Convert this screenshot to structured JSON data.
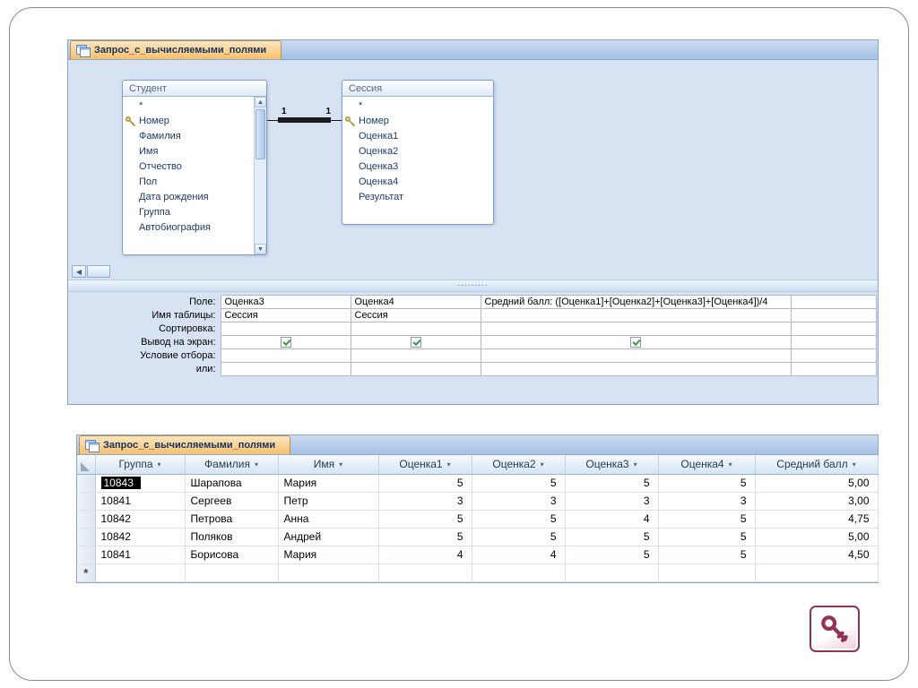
{
  "colors": {
    "design_background": "#d7e3f2",
    "active_tab": "#f7bf6b",
    "tab_strip": "#a5c1e4",
    "window_border": "#89a6c9",
    "field_text": "#1c3a6e",
    "checkbox_check": "#2f9e3f",
    "access_maroon": "#943157",
    "key_gold": "#a38f2e",
    "selected_cell_background": "#000000"
  },
  "design_window": {
    "tab_title": "Запрос_с_вычисляемыми_полями",
    "tables": [
      {
        "name": "Студент",
        "key_field": "Номер",
        "fields": [
          "*",
          "Номер",
          "Фамилия",
          "Имя",
          "Отчество",
          "Пол",
          "Дата рождения",
          "Группа",
          "Автобиография"
        ]
      },
      {
        "name": "Сессия",
        "key_field": "Номер",
        "fields": [
          "*",
          "Номер",
          "Оценка1",
          "Оценка2",
          "Оценка3",
          "Оценка4",
          "Результат"
        ]
      }
    ],
    "join": {
      "left_cardinality": "1",
      "right_cardinality": "1"
    },
    "splitter_dots": ".........",
    "scroll": {
      "left_arrow": "◀",
      "up_arrow": "▲",
      "down_arrow": "▼"
    },
    "grid": {
      "row_labels": [
        "Поле:",
        "Имя таблицы:",
        "Сортировка:",
        "Вывод на экран:",
        "Условие отбора:",
        "или:"
      ],
      "columns": [
        {
          "field": "Оценка3",
          "table": "Сессия",
          "sort": "",
          "show": true,
          "criteria": "",
          "or": ""
        },
        {
          "field": "Оценка4",
          "table": "Сессия",
          "sort": "",
          "show": true,
          "criteria": "",
          "or": ""
        },
        {
          "field": "Средний балл: ([Оценка1]+[Оценка2]+[Оценка3]+[Оценка4])/4",
          "table": "",
          "sort": "",
          "show": true,
          "criteria": "",
          "or": ""
        }
      ]
    }
  },
  "datasheet_window": {
    "tab_title": "Запрос_с_вычисляемыми_полями",
    "sort_arrow": "▾",
    "columns": [
      "Группа",
      "Фамилия",
      "Имя",
      "Оценка1",
      "Оценка2",
      "Оценка3",
      "Оценка4",
      "Средний балл"
    ],
    "numeric_columns": [
      3,
      4,
      5,
      6,
      7
    ],
    "rows": [
      [
        "10843",
        "Шарапова",
        "Мария",
        "5",
        "5",
        "5",
        "5",
        "5,00"
      ],
      [
        "10841",
        "Сергеев",
        "Петр",
        "3",
        "3",
        "3",
        "3",
        "3,00"
      ],
      [
        "10842",
        "Петрова",
        "Анна",
        "5",
        "5",
        "4",
        "5",
        "4,75"
      ],
      [
        "10842",
        "Поляков",
        "Андрей",
        "5",
        "5",
        "5",
        "5",
        "5,00"
      ],
      [
        "10841",
        "Борисова",
        "Мария",
        "4",
        "4",
        "5",
        "5",
        "4,50"
      ]
    ],
    "selected_cell": {
      "row": 0,
      "col": 0
    },
    "new_record_marker": "*"
  }
}
